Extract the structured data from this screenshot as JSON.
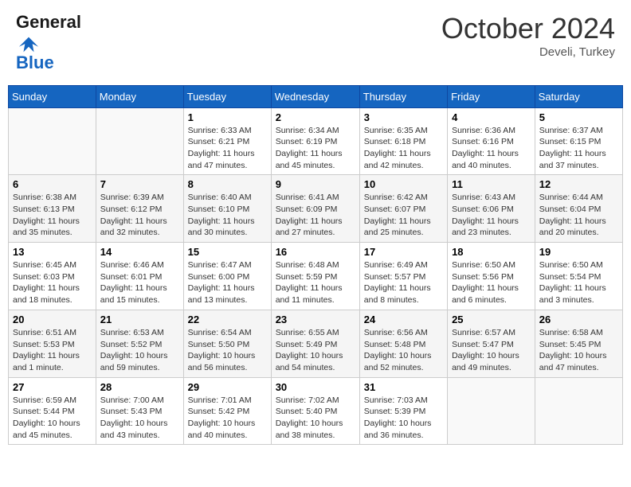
{
  "header": {
    "logo_line1": "General",
    "logo_line2": "Blue",
    "month": "October 2024",
    "location": "Develi, Turkey"
  },
  "days_of_week": [
    "Sunday",
    "Monday",
    "Tuesday",
    "Wednesday",
    "Thursday",
    "Friday",
    "Saturday"
  ],
  "weeks": [
    [
      {
        "day": "",
        "empty": true
      },
      {
        "day": "",
        "empty": true
      },
      {
        "day": "1",
        "sunrise": "6:33 AM",
        "sunset": "6:21 PM",
        "daylight": "11 hours and 47 minutes."
      },
      {
        "day": "2",
        "sunrise": "6:34 AM",
        "sunset": "6:19 PM",
        "daylight": "11 hours and 45 minutes."
      },
      {
        "day": "3",
        "sunrise": "6:35 AM",
        "sunset": "6:18 PM",
        "daylight": "11 hours and 42 minutes."
      },
      {
        "day": "4",
        "sunrise": "6:36 AM",
        "sunset": "6:16 PM",
        "daylight": "11 hours and 40 minutes."
      },
      {
        "day": "5",
        "sunrise": "6:37 AM",
        "sunset": "6:15 PM",
        "daylight": "11 hours and 37 minutes."
      }
    ],
    [
      {
        "day": "6",
        "sunrise": "6:38 AM",
        "sunset": "6:13 PM",
        "daylight": "11 hours and 35 minutes."
      },
      {
        "day": "7",
        "sunrise": "6:39 AM",
        "sunset": "6:12 PM",
        "daylight": "11 hours and 32 minutes."
      },
      {
        "day": "8",
        "sunrise": "6:40 AM",
        "sunset": "6:10 PM",
        "daylight": "11 hours and 30 minutes."
      },
      {
        "day": "9",
        "sunrise": "6:41 AM",
        "sunset": "6:09 PM",
        "daylight": "11 hours and 27 minutes."
      },
      {
        "day": "10",
        "sunrise": "6:42 AM",
        "sunset": "6:07 PM",
        "daylight": "11 hours and 25 minutes."
      },
      {
        "day": "11",
        "sunrise": "6:43 AM",
        "sunset": "6:06 PM",
        "daylight": "11 hours and 23 minutes."
      },
      {
        "day": "12",
        "sunrise": "6:44 AM",
        "sunset": "6:04 PM",
        "daylight": "11 hours and 20 minutes."
      }
    ],
    [
      {
        "day": "13",
        "sunrise": "6:45 AM",
        "sunset": "6:03 PM",
        "daylight": "11 hours and 18 minutes."
      },
      {
        "day": "14",
        "sunrise": "6:46 AM",
        "sunset": "6:01 PM",
        "daylight": "11 hours and 15 minutes."
      },
      {
        "day": "15",
        "sunrise": "6:47 AM",
        "sunset": "6:00 PM",
        "daylight": "11 hours and 13 minutes."
      },
      {
        "day": "16",
        "sunrise": "6:48 AM",
        "sunset": "5:59 PM",
        "daylight": "11 hours and 11 minutes."
      },
      {
        "day": "17",
        "sunrise": "6:49 AM",
        "sunset": "5:57 PM",
        "daylight": "11 hours and 8 minutes."
      },
      {
        "day": "18",
        "sunrise": "6:50 AM",
        "sunset": "5:56 PM",
        "daylight": "11 hours and 6 minutes."
      },
      {
        "day": "19",
        "sunrise": "6:50 AM",
        "sunset": "5:54 PM",
        "daylight": "11 hours and 3 minutes."
      }
    ],
    [
      {
        "day": "20",
        "sunrise": "6:51 AM",
        "sunset": "5:53 PM",
        "daylight": "11 hours and 1 minute."
      },
      {
        "day": "21",
        "sunrise": "6:53 AM",
        "sunset": "5:52 PM",
        "daylight": "10 hours and 59 minutes."
      },
      {
        "day": "22",
        "sunrise": "6:54 AM",
        "sunset": "5:50 PM",
        "daylight": "10 hours and 56 minutes."
      },
      {
        "day": "23",
        "sunrise": "6:55 AM",
        "sunset": "5:49 PM",
        "daylight": "10 hours and 54 minutes."
      },
      {
        "day": "24",
        "sunrise": "6:56 AM",
        "sunset": "5:48 PM",
        "daylight": "10 hours and 52 minutes."
      },
      {
        "day": "25",
        "sunrise": "6:57 AM",
        "sunset": "5:47 PM",
        "daylight": "10 hours and 49 minutes."
      },
      {
        "day": "26",
        "sunrise": "6:58 AM",
        "sunset": "5:45 PM",
        "daylight": "10 hours and 47 minutes."
      }
    ],
    [
      {
        "day": "27",
        "sunrise": "6:59 AM",
        "sunset": "5:44 PM",
        "daylight": "10 hours and 45 minutes."
      },
      {
        "day": "28",
        "sunrise": "7:00 AM",
        "sunset": "5:43 PM",
        "daylight": "10 hours and 43 minutes."
      },
      {
        "day": "29",
        "sunrise": "7:01 AM",
        "sunset": "5:42 PM",
        "daylight": "10 hours and 40 minutes."
      },
      {
        "day": "30",
        "sunrise": "7:02 AM",
        "sunset": "5:40 PM",
        "daylight": "10 hours and 38 minutes."
      },
      {
        "day": "31",
        "sunrise": "7:03 AM",
        "sunset": "5:39 PM",
        "daylight": "10 hours and 36 minutes."
      },
      {
        "day": "",
        "empty": true
      },
      {
        "day": "",
        "empty": true
      }
    ]
  ],
  "labels": {
    "sunrise_prefix": "Sunrise: ",
    "sunset_prefix": "Sunset: ",
    "daylight_prefix": "Daylight: "
  }
}
